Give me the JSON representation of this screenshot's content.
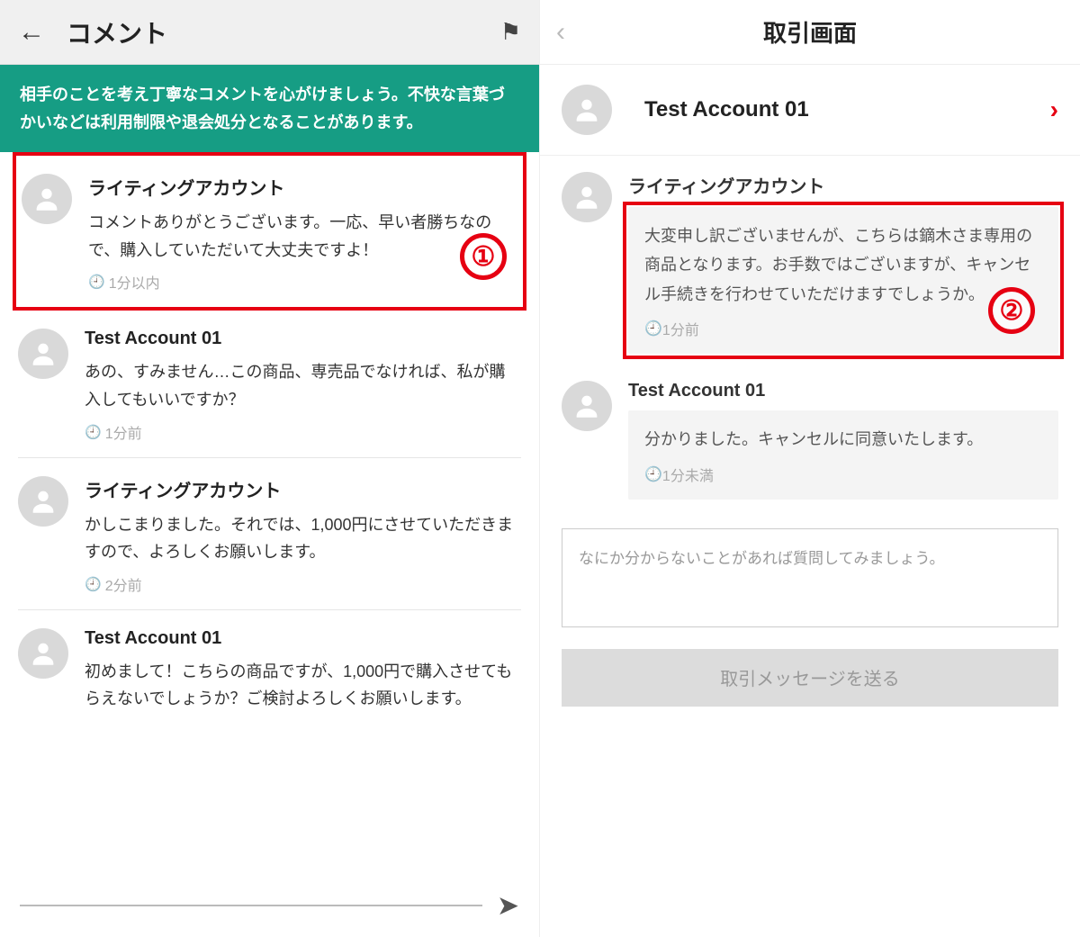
{
  "left": {
    "header_title": "コメント",
    "banner_text": "相手のことを考え丁寧なコメントを心がけましょう。不快な言葉づかいなどは利用制限や退会処分となることがあります。",
    "comments": [
      {
        "name": "ライティングアカウント",
        "text": "コメントありがとうございます。一応、早い者勝ちなので、購入していただいて大丈夫ですよ！",
        "time": "1分以内",
        "badge": "①"
      },
      {
        "name": "Test Account 01",
        "text": "あの、すみません…この商品、専売品でなければ、私が購入してもいいですか？",
        "time": "1分前"
      },
      {
        "name": "ライティングアカウント",
        "text": "かしこまりました。それでは、1,000円にさせていただきますので、よろしくお願いします。",
        "time": "2分前"
      },
      {
        "name": "Test Account 01",
        "text": "初めまして！こちらの商品ですが、1,000円で購入させてもらえないでしょうか？ご検討よろしくお願いします。",
        "time": ""
      }
    ]
  },
  "right": {
    "header_title": "取引画面",
    "account_name": "Test Account 01",
    "messages": [
      {
        "name": "ライティングアカウント",
        "text": "大変申し訳ございませんが、こちらは鏑木さま専用の商品となります。お手数ではございますが、キャンセル手続きを行わせていただけますでしょうか。",
        "time": "1分前",
        "badge": "②"
      },
      {
        "name": "Test Account 01",
        "text": "分かりました。キャンセルに同意いたします。",
        "time": "1分未満"
      }
    ],
    "input_placeholder": "なにか分からないことがあれば質問してみましょう。",
    "send_button": "取引メッセージを送る"
  }
}
